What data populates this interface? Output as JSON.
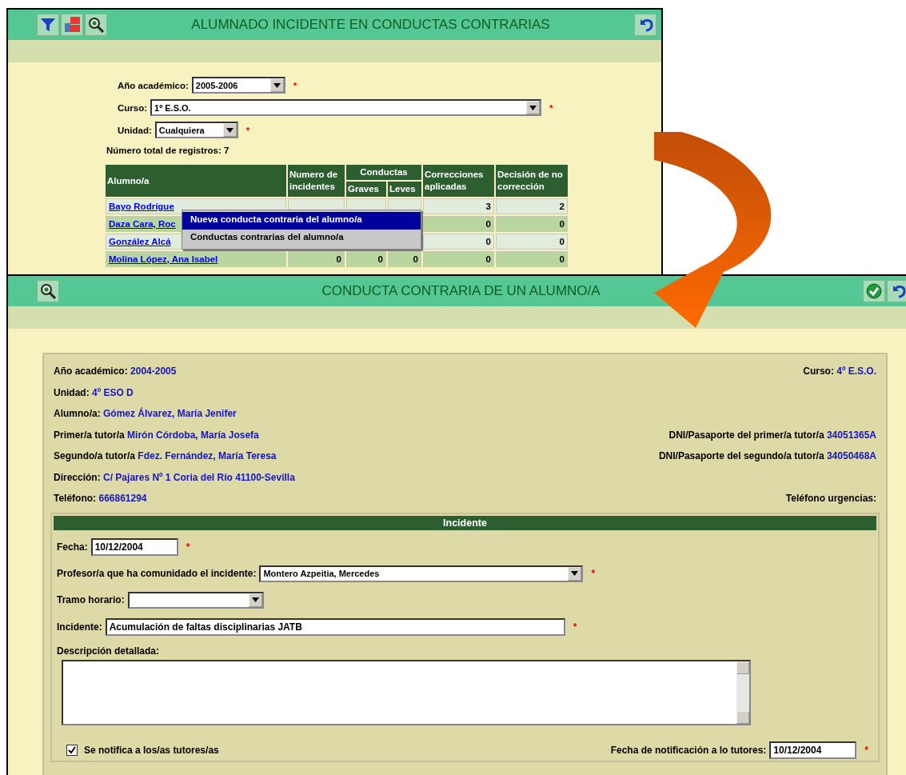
{
  "back_window": {
    "title": "ALUMNADO INCIDENTE EN CONDUCTAS CONTRARIAS",
    "filters": [
      {
        "label": "Año académico:",
        "value": "2005-2006",
        "kind": "select",
        "required_mark": "*"
      },
      {
        "label": "Curso:",
        "value": "1º E.S.O.",
        "kind": "select",
        "required_mark": "*"
      },
      {
        "label": "Unidad:",
        "value": "Cualquiera",
        "kind": "select",
        "required_mark": "*"
      }
    ],
    "total_records": {
      "label": "Número total de registros:",
      "value": "7"
    },
    "table": {
      "column_groups": [
        {
          "label": "Conductas"
        }
      ],
      "columns": [
        {
          "label": "Alumno/a",
          "kind": "single"
        },
        {
          "label": "Numero de incidentes",
          "kind": "single"
        },
        {
          "label": "Graves",
          "kind": "grouped"
        },
        {
          "label": "Leves",
          "kind": "grouped"
        },
        {
          "label": "Correcciones aplicadas",
          "kind": "single"
        },
        {
          "label": "Decisión de no corrección",
          "kind": "single"
        }
      ],
      "rows": [
        {
          "cells": [
            "Bayo Rodrígue",
            null,
            null,
            null,
            "3",
            "2"
          ]
        },
        {
          "cells": [
            "Daza Cara, Roc",
            null,
            null,
            null,
            "0",
            "0"
          ]
        },
        {
          "cells": [
            "González Alcá",
            null,
            null,
            null,
            "0",
            "0"
          ]
        },
        {
          "cells": [
            "Molina López, Ana Isabel",
            "0",
            "0",
            "0",
            "0",
            "0"
          ]
        }
      ]
    },
    "context_menu": {
      "items": [
        {
          "label": "Nueva conducta contraria del alumno/a",
          "selected": true
        },
        {
          "label": "Conductas contrarias del alumno/a",
          "selected": false
        }
      ]
    }
  },
  "front_window": {
    "title": "CONDUCTA CONTRARIA DE UN ALUMNO/A",
    "info_rows": [
      {
        "left": {
          "label": "Año académico:",
          "value": "2004-2005"
        },
        "right": {
          "label": "Curso:",
          "value": "4º E.S.O."
        }
      },
      {
        "left": {
          "label": "Unidad:",
          "value": "4º ESO D"
        }
      },
      {
        "left": {
          "label": "Alumno/a:",
          "value": "Gómez Álvarez, María Jenifer"
        }
      },
      {
        "left": {
          "label": "Primer/a tutor/a",
          "value": "Mirón Córdoba, María Josefa"
        },
        "right": {
          "label": "DNI/Pasaporte del primer/a tutor/a",
          "value": "34051365A"
        }
      },
      {
        "left": {
          "label": "Segundo/a tutor/a",
          "value": "Fdez. Fernández, María Teresa"
        },
        "right": {
          "label": "DNI/Pasaporte del segundo/a tutor/a",
          "value": "34050468A"
        }
      },
      {
        "left": {
          "label": "Dirección:",
          "value": "C/ Pajares Nº 1 Coria del Río 41100-Sevilla"
        }
      },
      {
        "left": {
          "label": "Teléfono:",
          "value": "666861294"
        },
        "right": {
          "label": "Teléfono urgencias:"
        }
      }
    ],
    "section_title": "Incidente",
    "fields": [
      {
        "label": "Fecha:",
        "value": "10/12/2004",
        "kind": "text",
        "required_mark": "*"
      },
      {
        "label": "Profesor/a que ha comunidado el incidente:",
        "value": "Montero Azpeitia, Mercedes",
        "kind": "select",
        "required_mark": "*"
      },
      {
        "label": "Tramo horario:",
        "kind": "select"
      },
      {
        "label": "Incidente:",
        "value": "Acumulación de faltas disciplinarias JATB",
        "kind": "text",
        "required_mark": "*"
      },
      {
        "label": "Descripción detallada:",
        "kind": "textarea"
      }
    ],
    "notify": {
      "label": "Se notifica a los/as tutores/as",
      "checked": true
    },
    "notification_date": {
      "label": "Fecha de notificación a lo tutores:",
      "value": "10/12/2004",
      "required_mark": "*"
    }
  }
}
